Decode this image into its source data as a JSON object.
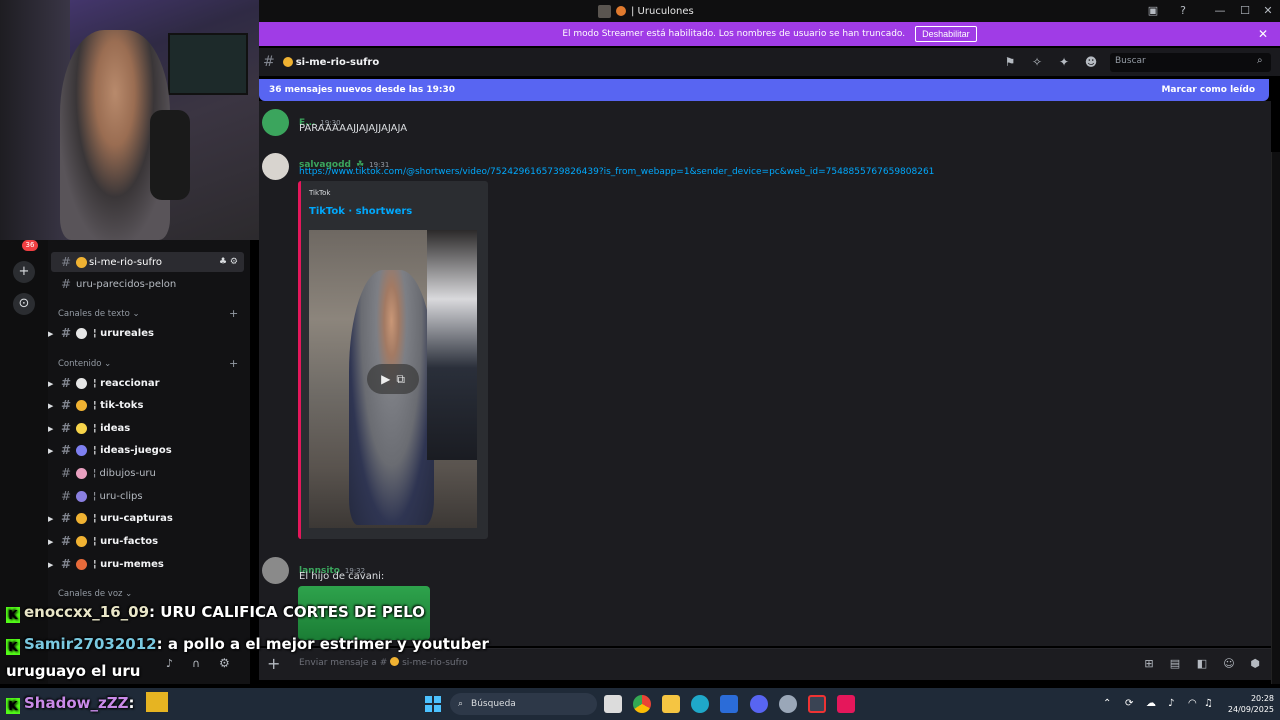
{
  "window": {
    "title": "| Uruculones"
  },
  "streamer_banner": {
    "text": "El modo Streamer está habilitado. Los nombres de usuario se han truncado.",
    "button": "Deshabilitar"
  },
  "channel_header": {
    "name": "si-me-rio-sufro",
    "search_placeholder": "Buscar"
  },
  "new_messages_bar": {
    "text": "36 mensajes nuevos desde las 19:30",
    "action": "Marcar como leído"
  },
  "messages": [
    {
      "user": "E...",
      "time": "19:30",
      "text": "PARAAAAAJJAJAJJAJAJA"
    },
    {
      "user": "salvagodd",
      "time": "19:31",
      "link": "https://www.tiktok.com/@shortwers/video/7524296165739826439?is_from_webapp=1&sender_device=pc&web_id=7548855767659808261",
      "embed": {
        "provider": "TikTok",
        "title": "TikTok · shortwers"
      }
    },
    {
      "user": "lannsito",
      "time": "19:32",
      "text": "El hijo de cavani:"
    }
  ],
  "composer": {
    "placeholder": "Enviar mensaje a #",
    "channel": "si-me-rio-sufro"
  },
  "sidebar": {
    "rail_badge": "36",
    "channels_top": [
      {
        "label": "si-me-rio-sufro",
        "active": true
      },
      {
        "label": "uru-parecidos-pelon"
      }
    ],
    "category_text": "Canales de texto",
    "text_channels": [
      {
        "label": "¦ urureales"
      }
    ],
    "category_content": "Contenido",
    "content_channels": [
      {
        "label": "¦ reaccionar",
        "unread": true
      },
      {
        "label": "¦ tik-toks",
        "unread": true
      },
      {
        "label": "¦ ideas",
        "unread": true
      },
      {
        "label": "¦ ideas-juegos",
        "unread": true
      },
      {
        "label": "¦ dibujos-uru"
      },
      {
        "label": "¦ uru-clips"
      },
      {
        "label": "¦ uru-capturas",
        "unread": true
      },
      {
        "label": "¦ uru-factos",
        "unread": true
      },
      {
        "label": "¦ uru-memes",
        "unread": true
      }
    ],
    "category_voice": "Canales de voz"
  },
  "chat_overlay": [
    {
      "user": "enoccxx_16_09",
      "text": ": URU CALIFICA CORTES DE PELO"
    },
    {
      "user": "Samir27032012",
      "text": ": a pollo a el mejor estrimer y youtuber"
    },
    {
      "user": "",
      "text": "uruguayo el uru"
    },
    {
      "user": "Shadow_zZZ",
      "text": ":"
    }
  ],
  "taskbar": {
    "search": "Búsqueda",
    "time": "20:28",
    "date": "24/09/2025"
  },
  "colors": {
    "accent": "#5865f2",
    "streamer": "#a03ce6",
    "kick_green": "#53fc18",
    "tiktok_border": "#e5175b"
  }
}
